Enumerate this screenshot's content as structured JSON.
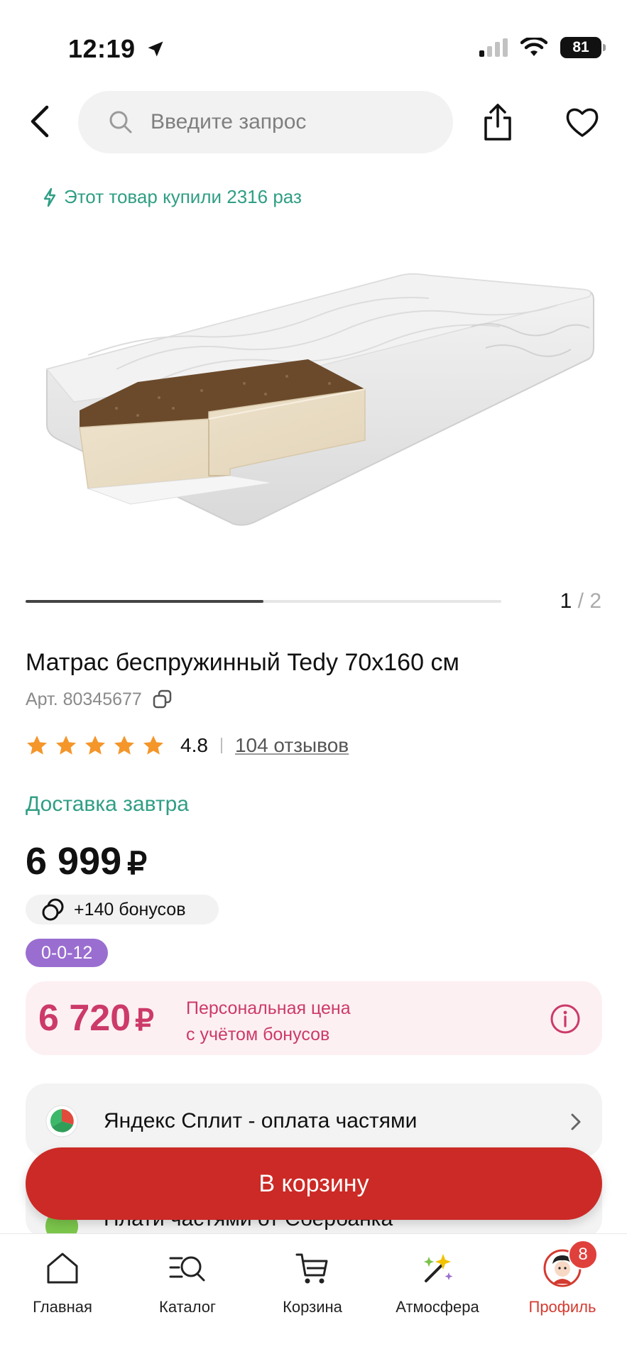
{
  "status_bar": {
    "time": "12:19",
    "battery": "81"
  },
  "search": {
    "placeholder": "Введите запрос"
  },
  "bought_note": "Этот товар купили 2316 раз",
  "gallery": {
    "current": "1",
    "separator": "/",
    "total": "2",
    "progress": 0.5
  },
  "product": {
    "title": "Матрас беспружинный Tedy 70x160 см",
    "article": "Арт. 80345677",
    "rating": "4.8",
    "stars": 5,
    "reviews": "104 отзывов",
    "delivery": "Доставка завтра",
    "price": "6 999",
    "currency": "₽",
    "bonus": "+140 бонусов",
    "installment_badge": "0-0-12"
  },
  "personal_price": {
    "price": "6 720",
    "currency": "₽",
    "line1": "Персональная цена",
    "line2": "с учётом бонусов"
  },
  "payment_options": [
    {
      "label": "Яндекс Сплит - оплата частями"
    },
    {
      "label": "Плати частями от Сбербанка"
    }
  ],
  "cart_button": "В корзину",
  "tabs": [
    {
      "label": "Главная",
      "icon": "home-icon"
    },
    {
      "label": "Каталог",
      "icon": "catalog-search-icon"
    },
    {
      "label": "Корзина",
      "icon": "cart-icon"
    },
    {
      "label": "Атмосфера",
      "icon": "magic-wand-icon"
    },
    {
      "label": "Профиль",
      "icon": "profile-avatar-icon",
      "badge": "8",
      "active": true
    }
  ],
  "colors": {
    "accent_red": "#cc2a26",
    "green": "#2f9e84",
    "pink": "#cc3a6a",
    "purple": "#9a6ed0"
  }
}
